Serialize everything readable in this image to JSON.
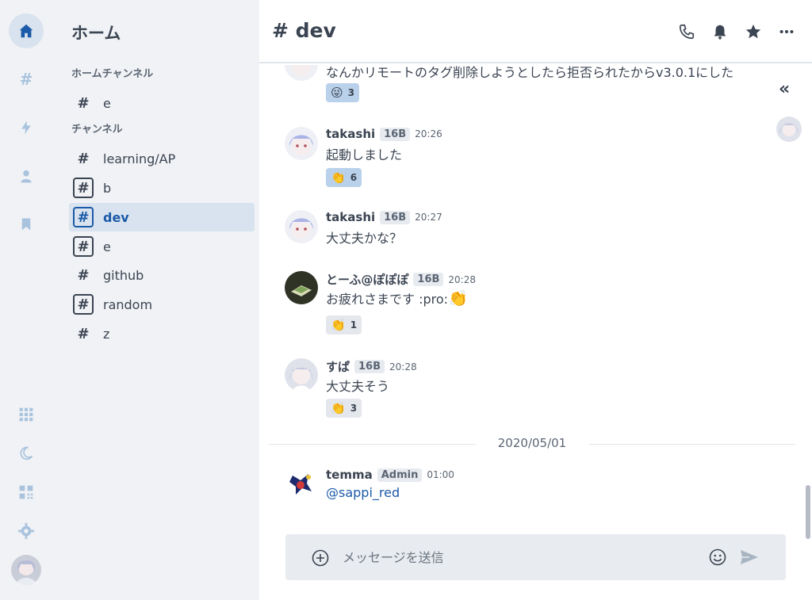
{
  "nav": {
    "title": "ホーム",
    "home_section": "ホームチャンネル",
    "home_channels": [
      {
        "label": "e"
      }
    ],
    "channels_section": "チャンネル",
    "channels": [
      {
        "label": "learning/AP"
      },
      {
        "label": "b"
      },
      {
        "label": "dev"
      },
      {
        "label": "e"
      },
      {
        "label": "github"
      },
      {
        "label": "random"
      },
      {
        "label": "z"
      }
    ]
  },
  "header": {
    "title": "# dev"
  },
  "messages": [
    {
      "body": "なんかリモートのタグ削除しようとしたら拒否られたからv3.0.1にした",
      "stamp": {
        "emoji": "😜",
        "count": "3"
      }
    },
    {
      "user": "takashi",
      "badge": "16B",
      "time": "20:26",
      "body": "起動しました",
      "stamp": {
        "emoji": "👏",
        "count": "6"
      }
    },
    {
      "user": "takashi",
      "badge": "16B",
      "time": "20:27",
      "body": "大丈夫かな？"
    },
    {
      "user": "とーふ@ぽぽぽ",
      "badge": "16B",
      "time": "20:28",
      "body": "お疲れさまです :pro:",
      "body_emoji": "👏",
      "stamp": {
        "emoji": "👏",
        "count": "1"
      }
    },
    {
      "user": "すぱ",
      "badge": "16B",
      "time": "20:28",
      "body": "大丈夫そう",
      "stamp": {
        "emoji": "👏",
        "count": "3"
      }
    },
    {
      "user": "temma",
      "badge": "Admin",
      "time": "01:00",
      "body": "@sappi_red"
    }
  ],
  "date_divider": "2020/05/01",
  "composer": {
    "placeholder": "メッセージを送信"
  },
  "colors": {
    "accent": "#1b5aa8",
    "sidebar_bg": "#f0f2f5",
    "active_bg": "#d8e3ef"
  }
}
